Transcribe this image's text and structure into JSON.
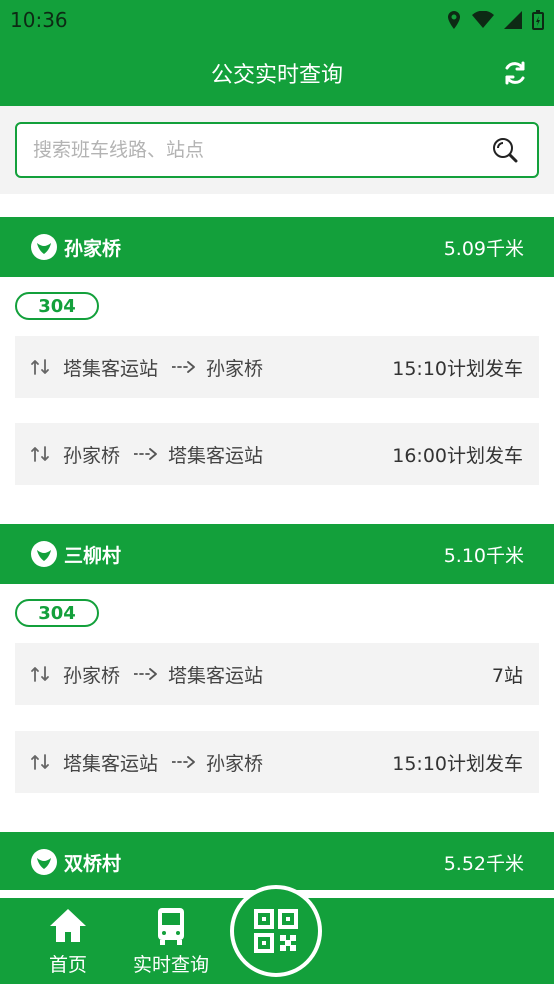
{
  "status_bar": {
    "time": "10:36"
  },
  "app_bar": {
    "title": "公交实时查询"
  },
  "search": {
    "placeholder": "搜索班车线路、站点"
  },
  "stations": [
    {
      "name": "孙家桥",
      "distance": "5.09千米",
      "route": "304",
      "trips": [
        {
          "from": "塔集客运站",
          "to": "孙家桥",
          "status": "15:10计划发车"
        },
        {
          "from": "孙家桥",
          "to": "塔集客运站",
          "status": "16:00计划发车"
        }
      ]
    },
    {
      "name": "三柳村",
      "distance": "5.10千米",
      "route": "304",
      "trips": [
        {
          "from": "孙家桥",
          "to": "塔集客运站",
          "status": "7站"
        },
        {
          "from": "塔集客运站",
          "to": "孙家桥",
          "status": "15:10计划发车"
        }
      ]
    },
    {
      "name": "双桥村",
      "distance": "5.52千米"
    }
  ],
  "bottom_nav": {
    "home": "首页",
    "realtime": "实时查询"
  },
  "colors": {
    "primary": "#13a03b",
    "card_bg": "#f3f3f3"
  }
}
